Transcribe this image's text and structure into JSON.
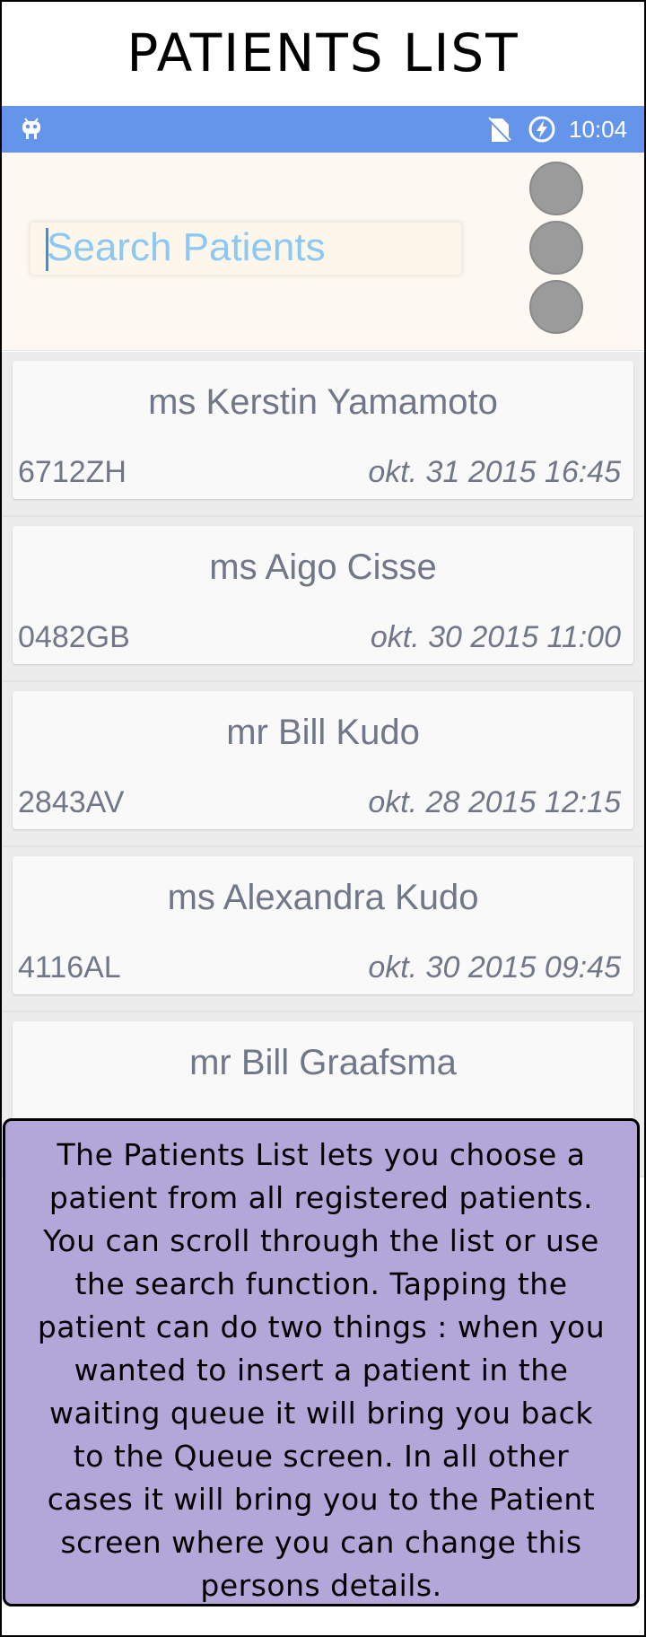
{
  "page": {
    "title": "PATIENTS LIST"
  },
  "statusbar": {
    "time": "10:04",
    "icons": [
      "android-icon",
      "no-sim-icon",
      "battery-charging-icon"
    ],
    "color": "#6495ea"
  },
  "search": {
    "placeholder": "Search Patients",
    "value": ""
  },
  "menu": {
    "icon": "overflow-menu-icon",
    "color": "#9b9b9b"
  },
  "patients": [
    {
      "name": "ms Kerstin Yamamoto",
      "code": "6712ZH",
      "date": "okt. 31 2015 16:45"
    },
    {
      "name": "ms Aigo Cisse",
      "code": "0482GB",
      "date": "okt. 30 2015 11:00"
    },
    {
      "name": "mr Bill Kudo",
      "code": "2843AV",
      "date": "okt. 28 2015 12:15"
    },
    {
      "name": "ms Alexandra Kudo",
      "code": "4116AL",
      "date": "okt. 30 2015 09:45"
    },
    {
      "name": "mr Bill Graafsma",
      "code": "",
      "date": ""
    }
  ],
  "tooltip": {
    "lines": [
      "The Patients List lets you choose a",
      "patient from all registered patients.",
      "You can scroll through the list or use",
      "the search function. Tapping the",
      "patient can do two things : when you",
      "wanted to insert a patient in the",
      "waiting queue it will bring you back",
      "to the Queue screen. In all other",
      "cases it will bring you to the Patient",
      "screen where you can change this",
      "persons details."
    ],
    "color": "#b2a7d8"
  }
}
